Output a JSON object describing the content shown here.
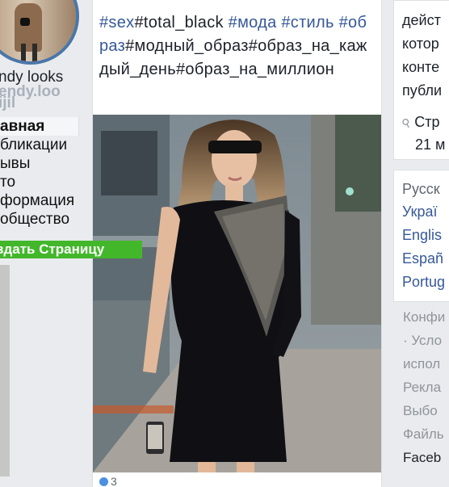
{
  "profile": {
    "name": "ndy looks",
    "handle": "endy.loo",
    "handle_suffix": "ijil"
  },
  "nav": {
    "items": [
      {
        "label": "авная",
        "active": true
      },
      {
        "label": "бликации",
        "active": false
      },
      {
        "label": "ывы",
        "active": false
      },
      {
        "label": "то",
        "active": false
      },
      {
        "label": "формация",
        "active": false
      },
      {
        "label": "общество",
        "active": false
      }
    ],
    "create_page_label": "здать Страницу"
  },
  "post": {
    "text_parts": [
      {
        "text": "#sex",
        "tag": true
      },
      {
        "text": "#total_black ",
        "tag": false
      },
      {
        "text": "#мода",
        "tag": true
      },
      {
        "text": " ",
        "tag": false
      },
      {
        "text": "#стиль",
        "tag": true
      },
      {
        "text": " ",
        "tag": false
      },
      {
        "text": "#образ",
        "tag": true
      },
      {
        "text": "#модный_образ#образ_на_каждый_день#образ_на_миллион",
        "tag": false
      }
    ],
    "reaction_count": "3"
  },
  "right_card1": {
    "lines": [
      "дейст",
      "котор",
      "конте",
      "публи"
    ],
    "meta_icon": "pin-icon",
    "meta_label": "Стр",
    "date": "21 м"
  },
  "languages": {
    "current": "Русск",
    "options": [
      "Украї",
      "Englis",
      "Españ",
      "Portug"
    ]
  },
  "footer": {
    "links": [
      "Конфи",
      "· Усло",
      "испол",
      "Рекла",
      "Выбо",
      "Файль"
    ],
    "brand": "Faceb"
  },
  "colors": {
    "link": "#365899",
    "create_button": "#42b72a",
    "page_bg": "#e9ebee",
    "avatar_ring": "#4a76a8"
  }
}
